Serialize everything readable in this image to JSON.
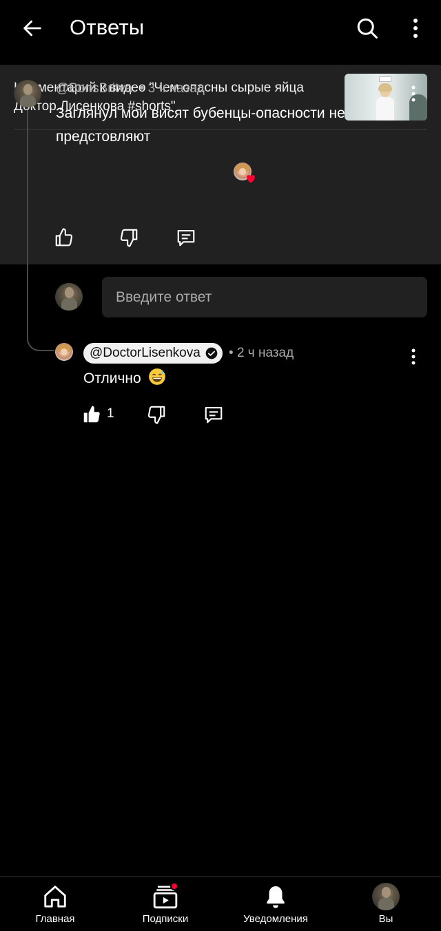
{
  "header": {
    "title": "Ответы",
    "back_icon": "arrow-left-icon",
    "search_icon": "search-icon",
    "more_icon": "more-vertical-icon"
  },
  "context": {
    "video_ref": "Комментарий к видео \"Чем опасны сырые яйца Доктор Лисенкова #shorts\""
  },
  "parent_comment": {
    "author": "@BorisBritva.",
    "time": "3 ч назад",
    "text": "Заглянул мои висят бубенцы-опасности не предстовляют",
    "creator_heart": true
  },
  "reply_box": {
    "placeholder": "Введите ответ"
  },
  "reply": {
    "author": "@DoctorLisenkova",
    "verified": true,
    "time": "2 ч назад",
    "text": "Отлично",
    "emoji": "grinning-sweat-emoji",
    "likes": "1"
  },
  "nav": {
    "items": [
      {
        "label": "Главная",
        "icon": "home-icon"
      },
      {
        "label": "Подписки",
        "icon": "subscriptions-icon",
        "badge": true
      },
      {
        "label": "Уведомления",
        "icon": "bell-icon"
      },
      {
        "label": "Вы",
        "icon": "profile-avatar"
      }
    ]
  },
  "colors": {
    "background": "#000000",
    "panel": "#212121",
    "meta_text": "#aaaaaa",
    "badge": "#ff0033"
  }
}
